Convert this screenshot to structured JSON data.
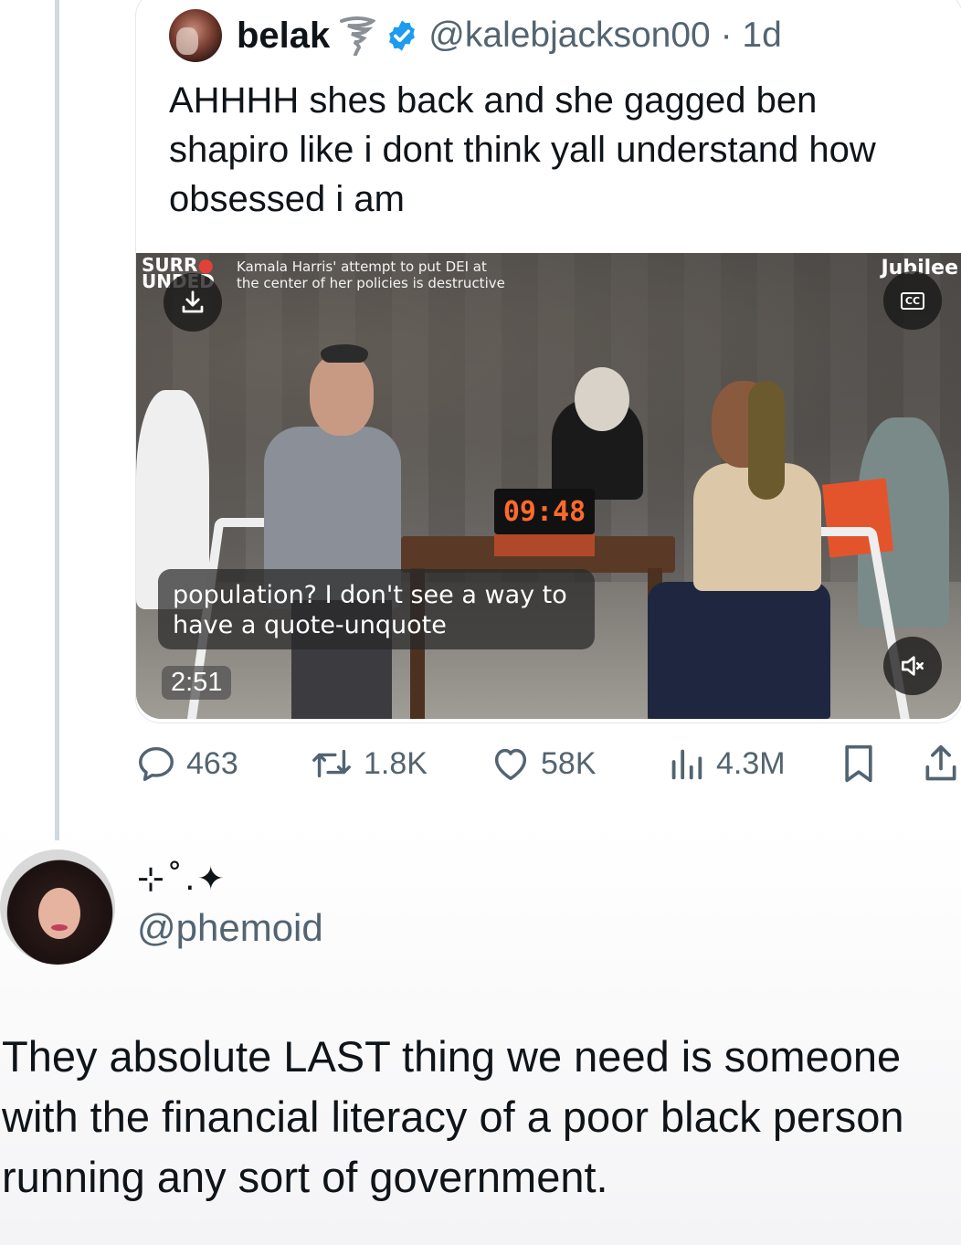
{
  "quoted_tweet": {
    "display_name": "belak",
    "name_emoji": "tornado-icon",
    "handle_time": "@kalebjackson00 · 1d",
    "text": "AHHHH shes back and she gagged ben shapiro like i dont think yall understand how obsessed i am",
    "video": {
      "brand_logo_line1": "SURR",
      "brand_logo_line2": "UNDED",
      "top_caption_line1": "Kamala Harris' attempt to put DEI at",
      "top_caption_line2": "the center of her policies is destructive",
      "channel_watermark": "Jubilee",
      "timer": "09:48",
      "subtitle_line1": "population? I don't see a way to",
      "subtitle_line2": "have a quote-unquote",
      "duration": "2:51",
      "cc_label": "CC"
    },
    "actions": {
      "replies": "463",
      "reposts": "1.8K",
      "likes": "58K",
      "views": "4.3M"
    }
  },
  "reply": {
    "display_name": "⊹˚.✦",
    "handle": "@phemoid",
    "text": "They absolute LAST thing we need is someone with the financial literacy of a poor black person running any sort of government."
  },
  "colors": {
    "verified": "#1d9bf0",
    "secondary_text": "#536471",
    "timer": "#ff6a2a"
  }
}
